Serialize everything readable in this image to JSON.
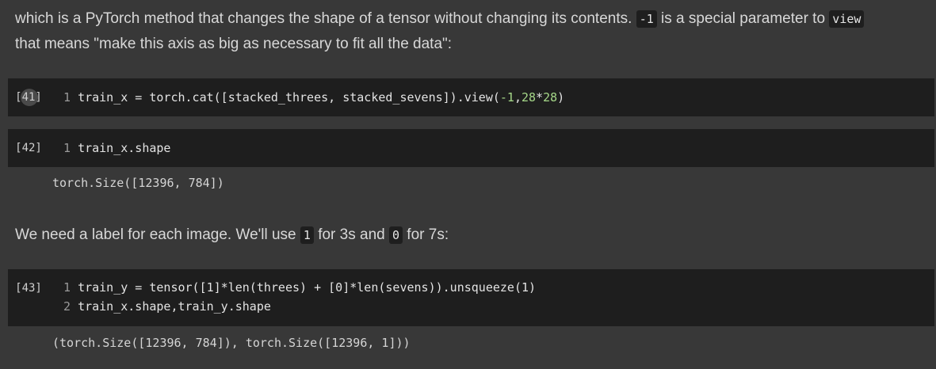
{
  "intro": {
    "text1": "which is a PyTorch method that changes the shape of a tensor without changing its contents. ",
    "code1": "-1",
    "text2": " is a special parameter to ",
    "code2": "view",
    "line2": "that means \"make this axis as big as necessary to fit all the data\":"
  },
  "cells": [
    {
      "prompt": "[41]",
      "lines": [
        {
          "no": "1",
          "pre": "train_x = torch.cat([stacked_threes, stacked_sevens]).view(",
          "num1": "-1",
          "mid": ",",
          "num2": "28",
          "op": "*",
          "num3": "28",
          "post": ")"
        }
      ]
    },
    {
      "prompt": "[42]",
      "lines": [
        {
          "no": "1",
          "text": "train_x.shape"
        }
      ],
      "output": "torch.Size([12396, 784])"
    },
    {
      "prompt": "[43]",
      "lines": [
        {
          "no": "1",
          "text": "train_y = tensor([1]*len(threes) + [0]*len(sevens)).unsqueeze(1)"
        },
        {
          "no": "2",
          "text": "train_x.shape,train_y.shape"
        }
      ],
      "output": "(torch.Size([12396, 784]), torch.Size([12396, 1]))"
    }
  ],
  "label_para": {
    "text1": "We need a label for each image. We'll use ",
    "code1": "1",
    "text2": " for 3s and ",
    "code2": "0",
    "text3": " for 7s:"
  }
}
